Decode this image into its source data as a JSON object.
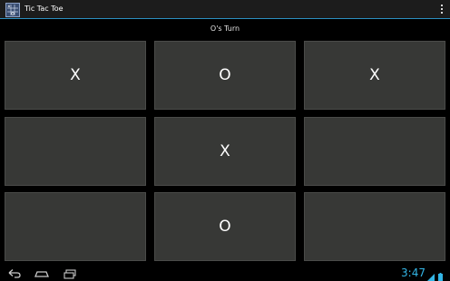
{
  "app": {
    "title": "Tic Tac Toe",
    "icon": "tic-tac-toe-app-icon"
  },
  "status": {
    "turn_text": "O's Turn"
  },
  "board": {
    "cells": [
      [
        "X",
        "O",
        "X"
      ],
      [
        "",
        "X",
        ""
      ],
      [
        "",
        "O",
        ""
      ]
    ]
  },
  "system_bar": {
    "clock": "3:47",
    "icons": [
      "back-icon",
      "home-icon",
      "recent-apps-icon",
      "wifi-icon",
      "battery-icon"
    ]
  },
  "colors": {
    "accent": "#33b5e5",
    "cell_background": "#373836",
    "background": "#000000"
  }
}
